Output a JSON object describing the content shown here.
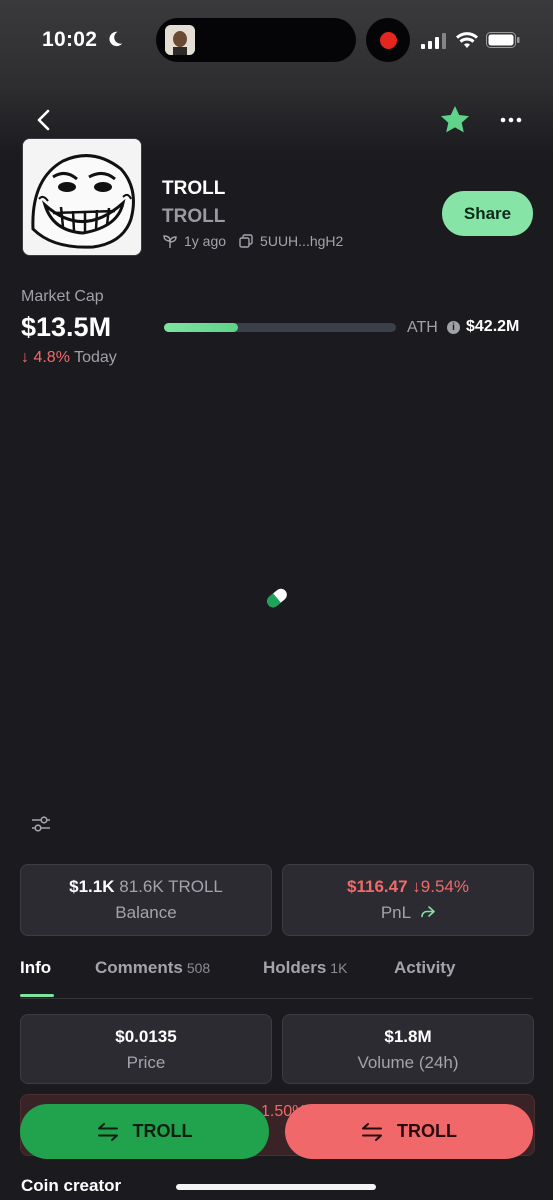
{
  "status_bar": {
    "time": "10:02",
    "icons": [
      "moon-icon",
      "signal-icon",
      "wifi-icon",
      "battery-icon",
      "record-icon"
    ]
  },
  "nav": {
    "icons": [
      "back-icon",
      "star-icon",
      "more-icon"
    ],
    "favorite_color": "#5fd38a"
  },
  "token": {
    "name": "TROLL",
    "symbol": "TROLL",
    "age": "1y ago",
    "address": "5UUH...hgH2",
    "share_label": "Share"
  },
  "market_cap": {
    "label": "Market Cap",
    "value": "$13.5M",
    "change_arrow": "↓",
    "change_pct": "4.8%",
    "change_period": "Today",
    "progress_fraction": 0.32,
    "ath_label": "ATH",
    "ath_value": "$42.2M"
  },
  "balance_card": {
    "value": "$1.1K",
    "amount": "81.6K TROLL",
    "label": "Balance"
  },
  "pnl_card": {
    "value": "$116.47",
    "change": "↓9.54%",
    "label": "PnL"
  },
  "tabs": [
    {
      "label": "Info",
      "count": ""
    },
    {
      "label": "Comments",
      "count": "508"
    },
    {
      "label": "Holders",
      "count": "1K"
    },
    {
      "label": "Activity",
      "count": ""
    }
  ],
  "stats": {
    "price_value": "$0.0135",
    "price_label": "Price",
    "volume_value": "$1.8M",
    "volume_label": "Volume (24h)",
    "partial_value": "1.50%"
  },
  "actions": {
    "buy_label": "TROLL",
    "sell_label": "TROLL",
    "buy_color": "#21a24c",
    "sell_color": "#f1686a"
  },
  "section": {
    "coin_creator": "Coin creator"
  }
}
